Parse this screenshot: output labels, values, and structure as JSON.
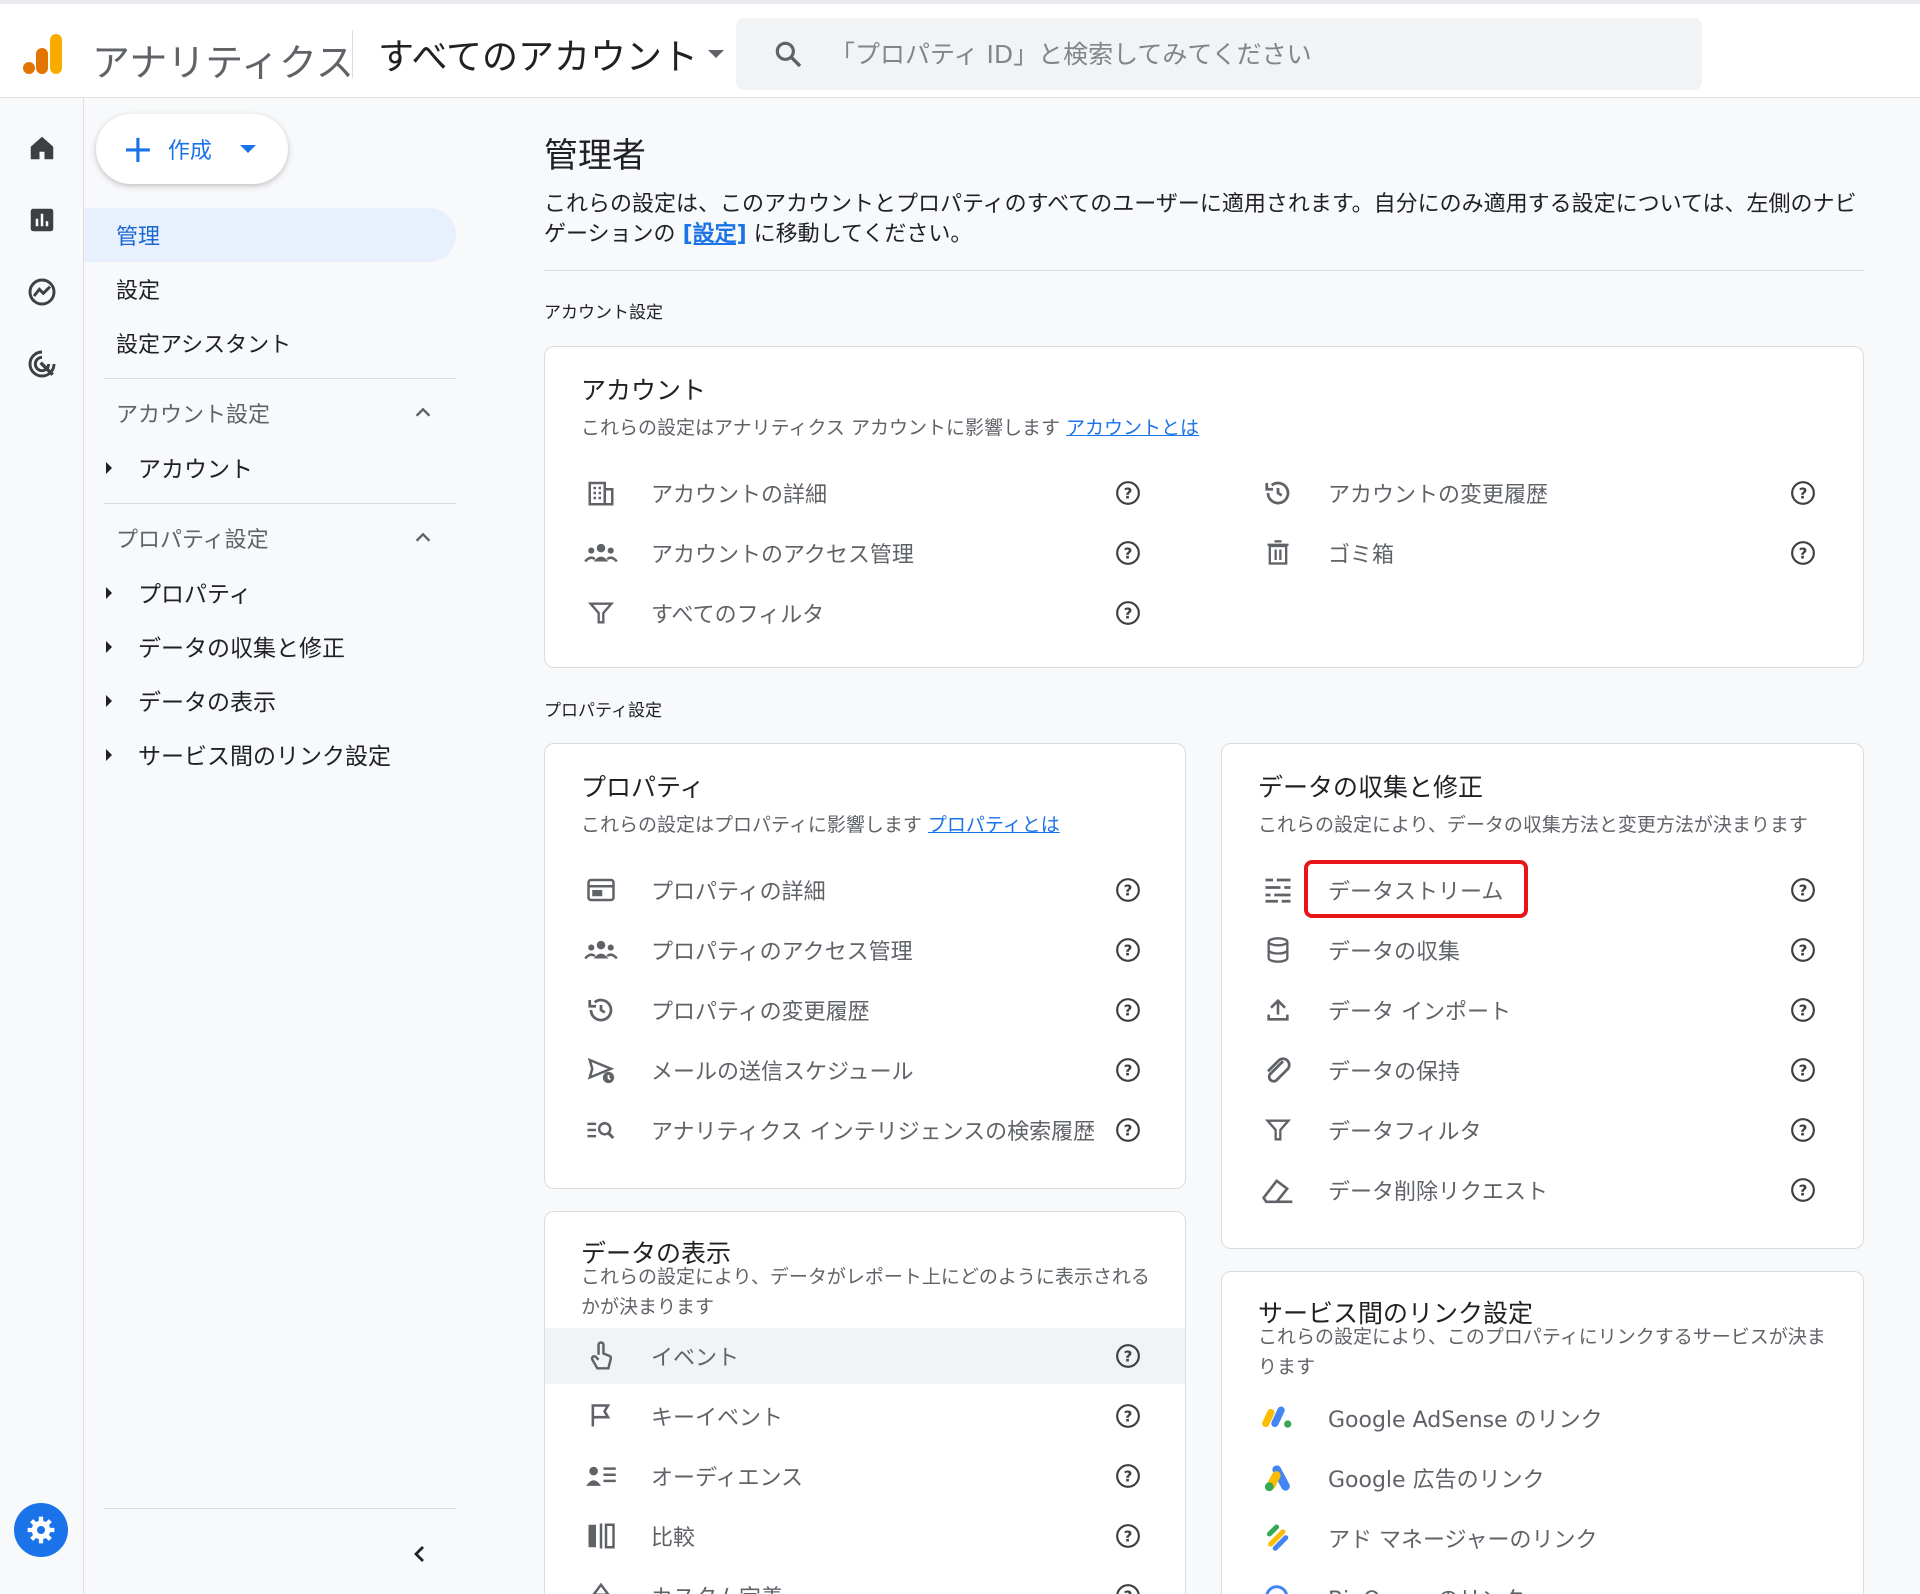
{
  "header": {
    "app_title": "アナリティクス",
    "account_selector": "すべてのアカウント",
    "search_placeholder": "「プロパティ ID」と検索してみてください"
  },
  "sidenav": {
    "create_label": "作成",
    "items": [
      {
        "label": "管理",
        "active": true
      },
      {
        "label": "設定"
      },
      {
        "label": "設定アシスタント"
      }
    ],
    "account_section": {
      "label": "アカウント設定",
      "children": [
        "アカウント"
      ]
    },
    "property_section": {
      "label": "プロパティ設定",
      "children": [
        "プロパティ",
        "データの収集と修正",
        "データの表示",
        "サービス間のリンク設定"
      ]
    }
  },
  "main": {
    "title": "管理者",
    "intro_before": "これらの設定は、このアカウントとプロパティのすべてのユーザーに適用されます。自分にのみ適用する設定については、左側のナビゲーションの ",
    "intro_link": "[設定]",
    "intro_after": " に移動してください。",
    "account_settings_label": "アカウント設定",
    "property_settings_label": "プロパティ設定",
    "account_card": {
      "title": "アカウント",
      "desc": "これらの設定はアナリティクス アカウントに影響します ",
      "desc_link": "アカウントとは",
      "left_items": [
        "アカウントの詳細",
        "アカウントのアクセス管理",
        "すべてのフィルタ"
      ],
      "right_items": [
        "アカウントの変更履歴",
        "ゴミ箱"
      ]
    },
    "property_card": {
      "title": "プロパティ",
      "desc": "これらの設定はプロパティに影響します ",
      "desc_link": "プロパティとは",
      "items": [
        "プロパティの詳細",
        "プロパティのアクセス管理",
        "プロパティの変更履歴",
        "メールの送信スケジュール",
        "アナリティクス インテリジェンスの検索履歴"
      ]
    },
    "collection_card": {
      "title": "データの収集と修正",
      "desc": "これらの設定により、データの収集方法と変更方法が決まります",
      "items": [
        "データストリーム",
        "データの収集",
        "データ インポート",
        "データの保持",
        "データフィルタ",
        "データ削除リクエスト"
      ]
    },
    "display_card": {
      "title": "データの表示",
      "desc": "これらの設定により、データがレポート上にどのように表示されるかが決まります",
      "items": [
        "イベント",
        "キーイベント",
        "オーディエンス",
        "比較",
        "カスタム定義"
      ]
    },
    "links_card": {
      "title": "サービス間のリンク設定",
      "desc": "これらの設定により、このプロパティにリンクするサービスが決まります",
      "items": [
        "Google AdSense のリンク",
        "Google 広告のリンク",
        "アド マネージャーのリンク",
        "BigQuery のリンク"
      ]
    }
  },
  "colors": {
    "accent": "#1a73e8",
    "highlight_box": "#e8141b",
    "logo_orange": "#f9ab00",
    "logo_dark_orange": "#e37400"
  }
}
